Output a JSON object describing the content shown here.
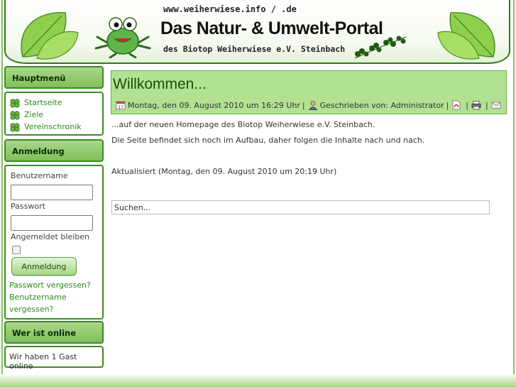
{
  "header": {
    "url": "www.weiherwiese.info / .de",
    "title": "Das Natur- & Umwelt-Portal",
    "subtitle": "des Biotop Weiherwiese e.V. Steinbach"
  },
  "sidebar": {
    "main_menu": {
      "heading": "Hauptmenü",
      "items": [
        {
          "label": "Startseite",
          "icon": "clover-icon"
        },
        {
          "label": "Ziele",
          "icon": "clover-icon"
        },
        {
          "label": "Vereinschronik",
          "icon": "clover-icon"
        }
      ]
    },
    "login": {
      "heading": "Anmeldung",
      "username_label": "Benutzername",
      "password_label": "Passwort",
      "remember_label": "Angemeldet bleiben",
      "button_label": "Anmeldung",
      "forgot_password": "Passwort vergessen?",
      "forgot_username": "Benutzername vergessen?"
    },
    "online": {
      "heading": "Wer ist online",
      "text": "Wir haben 1 Gast online"
    }
  },
  "article": {
    "title": "Willkommen...",
    "date": "Montag, den 09. August 2010 um 16:29 Uhr",
    "author": "Geschrieben von: Administrator",
    "icons": [
      "calendar-icon",
      "user-icon",
      "pdf-icon",
      "print-icon",
      "email-icon"
    ],
    "para1": "...auf der neuen Homepage des Biotop Weiherwiese e.V. Steinbach.",
    "para2": "Die Seite befindet sich noch im Aufbau, daher folgen die Inhalte nach und nach.",
    "updated": "Aktualisiert (Montag, den 09. August 2010 um 20:19 Uhr)"
  },
  "search": {
    "value": "Suchen..."
  },
  "colors": {
    "accent_green": "#7fc05a",
    "border_green": "#3c8a26",
    "link_green": "#2d8a1a",
    "article_head_bg": "#b2e191"
  }
}
